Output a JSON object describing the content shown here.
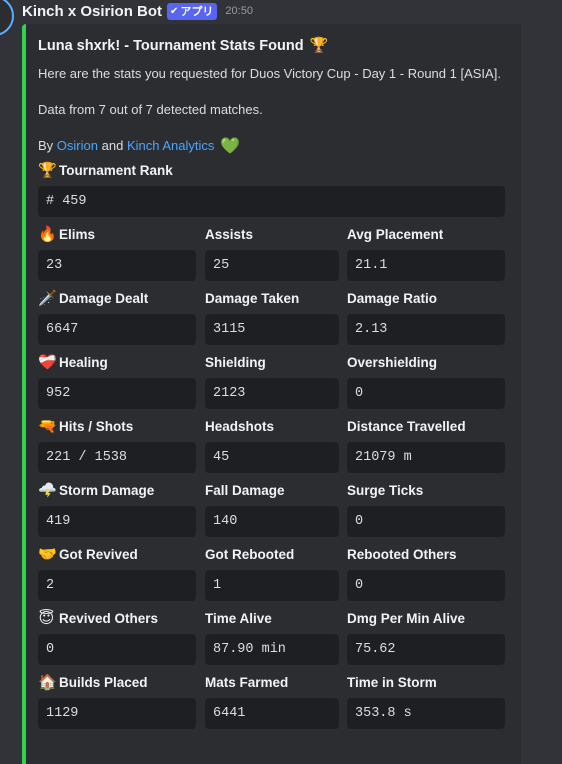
{
  "header": {
    "bot_name": "Kinch x Osirion Bot",
    "badge": "アプリ",
    "badge_icon": "check-icon",
    "timestamp": "20:50"
  },
  "embed": {
    "accent_color": "#2ed34e",
    "title": "Luna shxrk! - Tournament Stats Found",
    "title_emoji": "🏆",
    "description_line1": "Here are the stats you requested for Duos Victory Cup - Day 1 - Round 1 [ASIA].",
    "description_line2": "Data from 7 out of 7 detected matches.",
    "by_prefix": "By",
    "link1": "Osirion",
    "and_text": "and",
    "link2": "Kinch Analytics",
    "heart_emoji": "💚",
    "fields": [
      {
        "name": "Tournament Rank",
        "emoji": "🏆",
        "value": "# 459"
      },
      {
        "name": "Elims",
        "emoji": "🔥",
        "value": "23"
      },
      {
        "name": "Assists",
        "value": "25"
      },
      {
        "name": "Avg Placement",
        "value": "21.1"
      },
      {
        "name": "Damage Dealt",
        "emoji": "🗡️",
        "value": "6647"
      },
      {
        "name": "Damage Taken",
        "value": "3115"
      },
      {
        "name": "Damage Ratio",
        "value": "2.13"
      },
      {
        "name": "Healing",
        "emoji": "❤️‍🩹",
        "value": "952"
      },
      {
        "name": "Shielding",
        "value": "2123"
      },
      {
        "name": "Overshielding",
        "value": "0"
      },
      {
        "name": "Hits / Shots",
        "emoji": "🔫",
        "value": "221 / 1538"
      },
      {
        "name": "Headshots",
        "value": "45"
      },
      {
        "name": "Distance Travelled",
        "value": "21079 m"
      },
      {
        "name": "Storm Damage",
        "emoji": "🌩️",
        "value": "419"
      },
      {
        "name": "Fall Damage",
        "value": "140"
      },
      {
        "name": "Surge Ticks",
        "value": "0"
      },
      {
        "name": "Got Revived",
        "emoji": "🤝",
        "value": "2"
      },
      {
        "name": "Got Rebooted",
        "value": "1"
      },
      {
        "name": "Rebooted Others",
        "value": "0"
      },
      {
        "name": "Revived Others",
        "emoji": "😇",
        "value": "0"
      },
      {
        "name": "Time Alive",
        "value": "87.90 min"
      },
      {
        "name": "Dmg Per Min Alive",
        "value": "75.62"
      },
      {
        "name": "Builds Placed",
        "emoji": "🏠",
        "value": "1129"
      },
      {
        "name": "Mats Farmed",
        "value": "6441"
      },
      {
        "name": "Time in Storm",
        "value": "353.8 s"
      }
    ]
  }
}
